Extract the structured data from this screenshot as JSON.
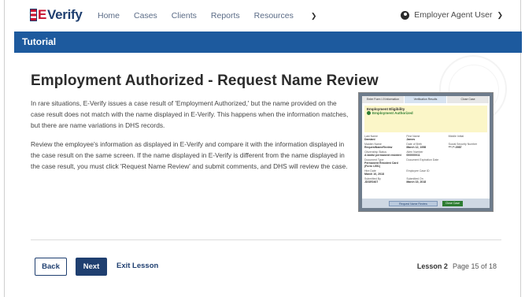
{
  "brand": {
    "logo_text": "Verify",
    "logo_prefix": "E"
  },
  "nav": {
    "items": [
      {
        "label": "Home"
      },
      {
        "label": "Cases"
      },
      {
        "label": "Clients"
      },
      {
        "label": "Reports"
      },
      {
        "label": "Resources"
      }
    ],
    "user_label": "Employer Agent User"
  },
  "tutorial_bar": {
    "label": "Tutorial"
  },
  "main": {
    "title": "Employment Authorized - Request Name Review",
    "paragraph_1": "In rare situations, E-Verify issues a case result of 'Employment Authorized,' but the name provided on the case result does not match with the name displayed in E-Verify. This happens when the information matches, but there are name variations in DHS records.",
    "paragraph_2": "Review the employee's information as displayed in E-Verify and compare it with the information displayed in the case result on the same screen. If the name displayed in E-Verify is different from the name displayed in the case result, you must click 'Request Name Review' and submit comments, and DHS will review the case."
  },
  "preview": {
    "steps": [
      "Enter Form I-9 Information",
      "Verification Results",
      "Close Case"
    ],
    "eligibility_heading": "Employment Eligibility",
    "status": "Employment Authorized",
    "fields": [
      {
        "label": "Last Name",
        "value": "Damiani"
      },
      {
        "label": "First Name",
        "value": "James"
      },
      {
        "label": "Middle Initial",
        "value": ""
      },
      {
        "label": "Maiden Name",
        "value": "RequestNameReview"
      },
      {
        "label": "Date of Birth",
        "value": "March 12, 1958"
      },
      {
        "label": "Social Security Number",
        "value": "***-**-0987"
      },
      {
        "label": "Citizenship Status",
        "value": "A lawful permanent resident"
      },
      {
        "label": "Alien Number",
        "value": "000000011"
      },
      {
        "label": "",
        "value": ""
      },
      {
        "label": "Document Type",
        "value": "Permanent Resident Card (Form I-551)"
      },
      {
        "label": "Document Expiration Date",
        "value": ""
      },
      {
        "label": "",
        "value": ""
      },
      {
        "label": "Hire Date",
        "value": "March 10, 2018"
      },
      {
        "label": "Employee Case ID",
        "value": ""
      },
      {
        "label": "",
        "value": ""
      },
      {
        "label": "Submitted By",
        "value": "JDOE0407"
      },
      {
        "label": "Submitted On",
        "value": "March 15, 2018"
      },
      {
        "label": "",
        "value": ""
      }
    ],
    "request_button": "Request Name Review",
    "close_button": "Close Case"
  },
  "footer": {
    "back_label": "Back",
    "next_label": "Next",
    "exit_label": "Exit Lesson",
    "lesson_label": "Lesson 2",
    "page_label": "Page 15 of 18"
  }
}
